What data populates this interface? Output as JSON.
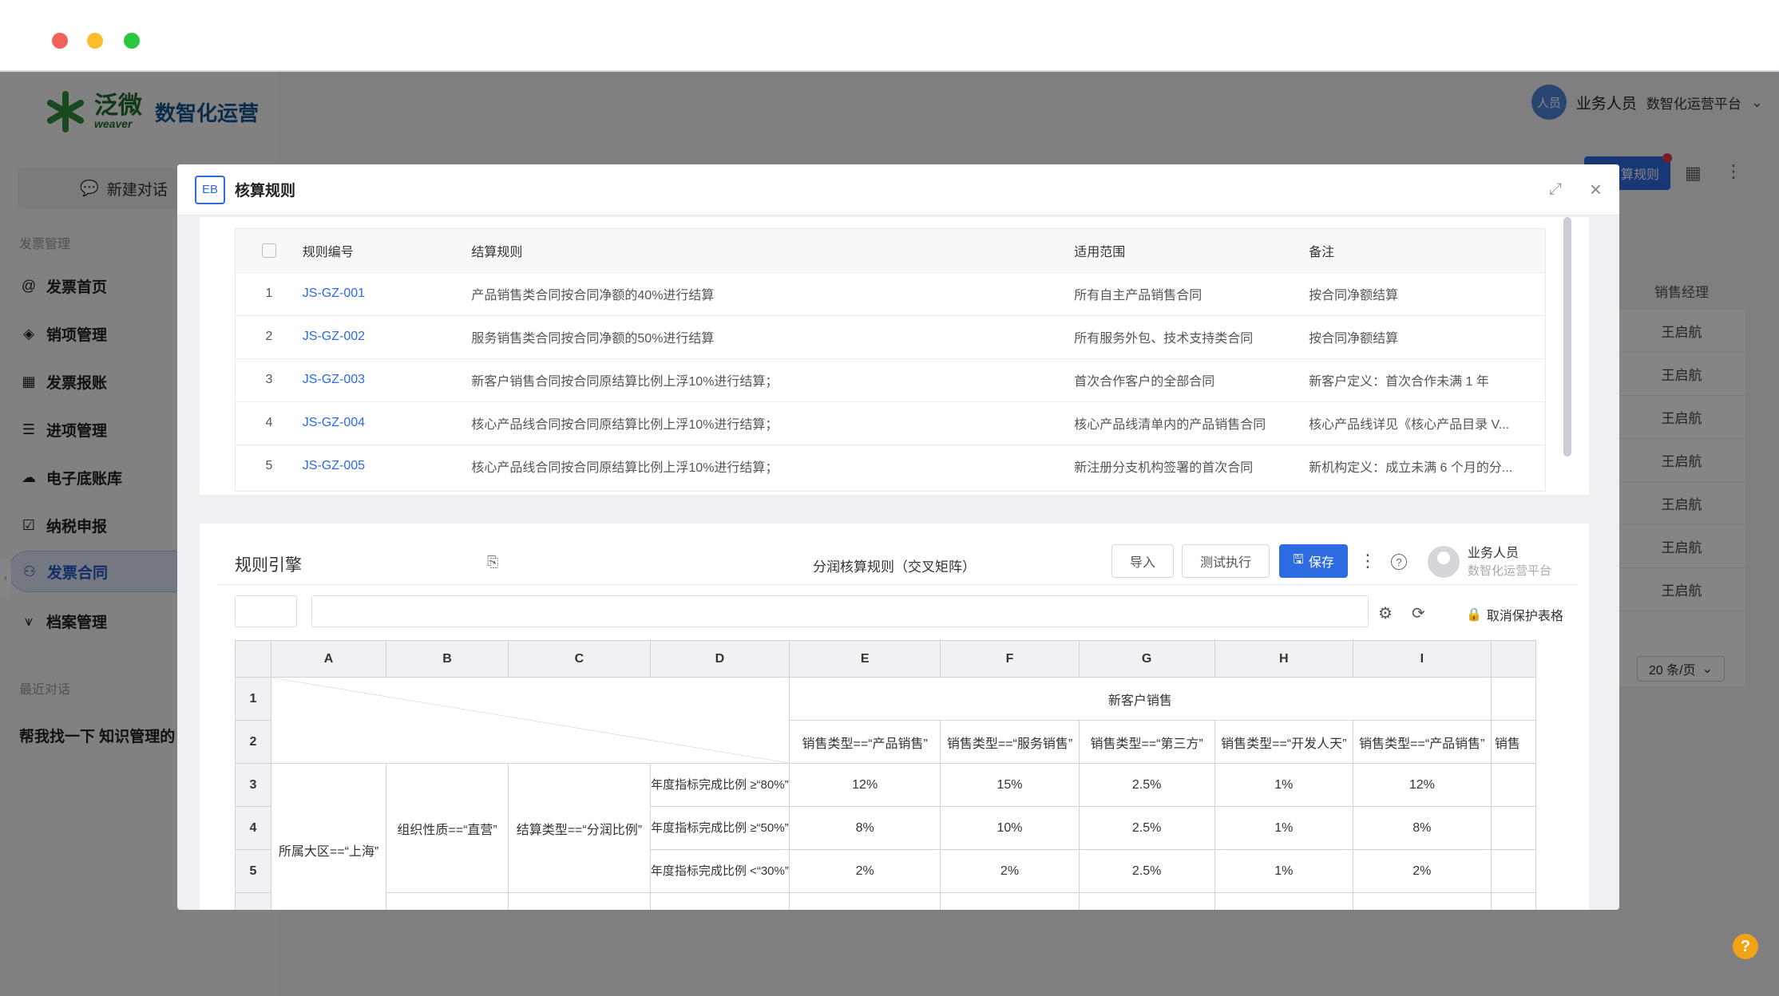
{
  "logo": {
    "cn": "泛微",
    "en": "weaver",
    "sub": "数智化运营"
  },
  "sidebar": {
    "new_chat": "新建对话",
    "section_invoice": "发票管理",
    "items": [
      {
        "label": "发票首页",
        "icon": "at-icon"
      },
      {
        "label": "销项管理",
        "icon": "layers-icon"
      },
      {
        "label": "发票报账",
        "icon": "table-icon"
      },
      {
        "label": "进项管理",
        "icon": "list-icon"
      },
      {
        "label": "电子底账库",
        "icon": "cloud-icon"
      },
      {
        "label": "纳税申报",
        "icon": "checkbox-icon"
      },
      {
        "label": "发票合同",
        "icon": "users-icon"
      },
      {
        "label": "档案管理",
        "icon": "archive-icon"
      }
    ],
    "section_recent": "最近对话",
    "recent_item": "帮我找一下 知识管理的"
  },
  "topbar": {
    "avatar": "人员",
    "user": "业务人员",
    "platform": "数智化运营平台"
  },
  "background": {
    "button": "算规则",
    "col_header": "销售经理",
    "col_values": [
      "王启航",
      "王启航",
      "王启航",
      "王启航",
      "王启航",
      "王启航",
      "王启航"
    ],
    "pager": "20 条/页"
  },
  "modal": {
    "badge": "EB",
    "title": "核算规则",
    "table": {
      "headers": [
        "规则编号",
        "结算规则",
        "适用范围",
        "备注"
      ],
      "rows": [
        {
          "no": "1",
          "id": "JS-GZ-001",
          "rule": "产品销售类合同按合同净额的40%进行结算",
          "scope": "所有自主产品销售合同",
          "note": "按合同净额结算"
        },
        {
          "no": "2",
          "id": "JS-GZ-002",
          "rule": "服务销售类合同按合同净额的50%进行结算",
          "scope": "所有服务外包、技术支持类合同",
          "note": "按合同净额结算"
        },
        {
          "no": "3",
          "id": "JS-GZ-003",
          "rule": "新客户销售合同按合同原结算比例上浮10%进行结算；",
          "scope": "首次合作客户的全部合同",
          "note": "新客户定义：首次合作未满 1 年"
        },
        {
          "no": "4",
          "id": "JS-GZ-004",
          "rule": "核心产品线合同按合同原结算比例上浮10%进行结算；",
          "scope": "核心产品线清单内的产品销售合同",
          "note": "核心产品线详见《核心产品目录 V..."
        },
        {
          "no": "5",
          "id": "JS-GZ-005",
          "rule": "核心产品线合同按合同原结算比例上浮10%进行结算；",
          "scope": "新注册分支机构签署的首次合同",
          "note": "新机构定义：成立未满 6 个月的分..."
        }
      ]
    },
    "engine": {
      "title": "规则引擎",
      "sheet_name": "分润核算规则（交叉矩阵）",
      "import": "导入",
      "test_run": "测试执行",
      "save": "保存",
      "user": "业务人员",
      "platform": "数智化运营平台",
      "unprotect": "取消保护表格"
    },
    "sheet": {
      "cols": [
        "A",
        "B",
        "C",
        "D",
        "E",
        "F",
        "G",
        "H",
        "I",
        ""
      ],
      "rows": [
        "1",
        "2",
        "3",
        "4",
        "5",
        ""
      ],
      "group_header": "新客户销售",
      "sale_types": [
        "销售类型==“产品销售”",
        "销售类型==“服务销售”",
        "销售类型==“第三方”",
        "销售类型==“开发人天”",
        "销售类型==“产品销售”",
        "销售"
      ],
      "cond_a": "所属大区==“上海”",
      "cond_b": "组织性质==“直营”",
      "cond_c": "结算类型==“分润比例”",
      "cond_d": [
        "年度指标完成比例 ≥“80%”",
        "年度指标完成比例 ≥“50%”",
        "年度指标完成比例 <“30%”"
      ],
      "values": [
        [
          "12%",
          "15%",
          "2.5%",
          "1%",
          "12%"
        ],
        [
          "8%",
          "10%",
          "2.5%",
          "1%",
          "8%"
        ],
        [
          "2%",
          "2%",
          "2.5%",
          "1%",
          "2%"
        ]
      ]
    }
  }
}
